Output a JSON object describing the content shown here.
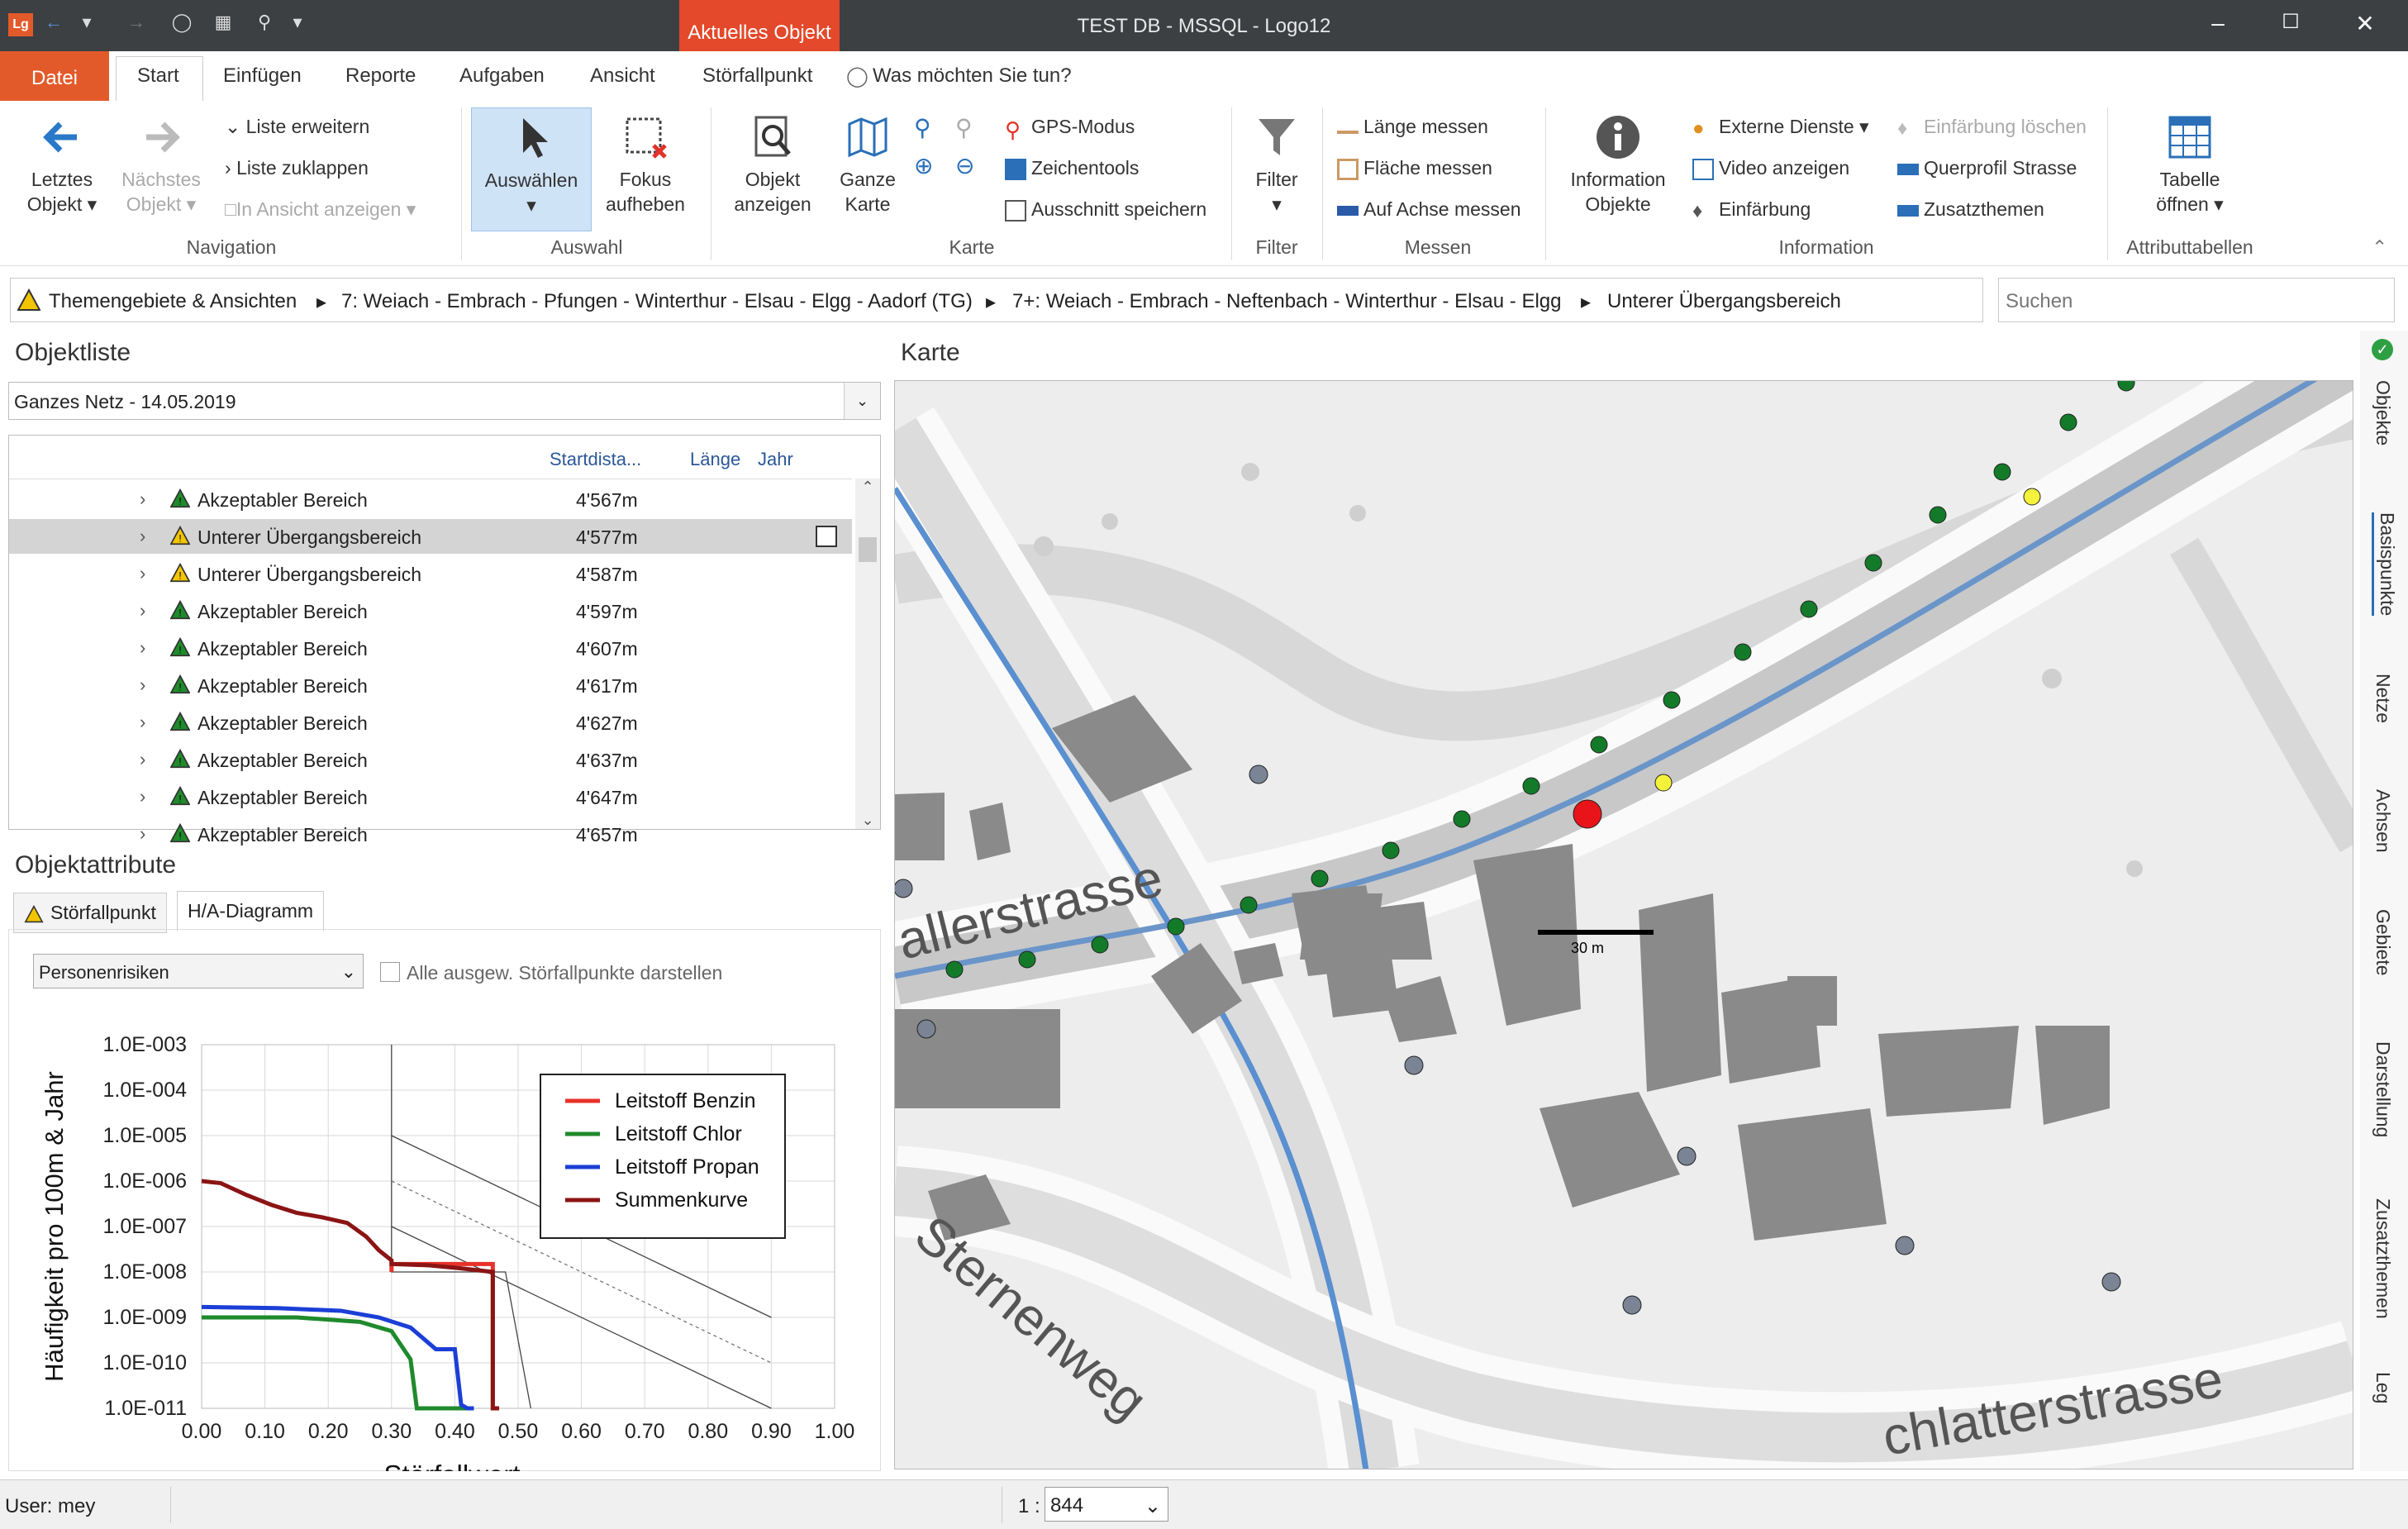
{
  "window": {
    "title": "TEST DB - MSSQL - Logo12",
    "context_tab": "Aktuelles Objekt",
    "app_icon": "Lg"
  },
  "ribbon_tabs": [
    "Datei",
    "Start",
    "Einfügen",
    "Reporte",
    "Aufgaben",
    "Ansicht",
    "Störfallpunkt"
  ],
  "tell_me": "Was möchten Sie tun?",
  "ribbon": {
    "navigation": {
      "label": "Navigation",
      "last_object": [
        "Letztes",
        "Objekt"
      ],
      "next_object": [
        "Nächstes",
        "Objekt"
      ],
      "expand_list": "Liste erweitern",
      "collapse_list": "Liste zuklappen",
      "show_in_view": "In Ansicht anzeigen"
    },
    "auswahl": {
      "label": "Auswahl",
      "select": "Auswählen",
      "focus": [
        "Fokus",
        "aufheben"
      ]
    },
    "karte": {
      "label": "Karte",
      "show_object": [
        "Objekt",
        "anzeigen"
      ],
      "whole_map": [
        "Ganze",
        "Karte"
      ],
      "gps": "GPS-Modus",
      "drawing_tools": "Zeichentools",
      "save_clip": "Ausschnitt speichern"
    },
    "filter": {
      "label": "Filter",
      "button": "Filter"
    },
    "messen": {
      "label": "Messen",
      "length": "Länge messen",
      "area": "Fläche messen",
      "axis": "Auf Achse messen"
    },
    "information": {
      "label": "Information",
      "info_objects": [
        "Information",
        "Objekte"
      ],
      "external": "Externe Dienste",
      "video": "Video anzeigen",
      "coloring": "Einfärbung",
      "clear_coloring": "Einfärbung löschen",
      "profile": "Querprofil Strasse",
      "extra_themes": "Zusatzthemen"
    },
    "attributtabellen": {
      "label": "Attributtabellen",
      "open_table": [
        "Tabelle",
        "öffnen"
      ]
    }
  },
  "breadcrumb": [
    "Themengebiete & Ansichten",
    "7: Weiach - Embrach - Pfungen - Winterthur - Elsau - Elgg - Aadorf (TG)",
    "7+: Weiach - Embrach - Neftenbach - Winterthur - Elsau - Elgg",
    "Unterer Übergangsbereich"
  ],
  "search_placeholder": "Suchen",
  "objektliste": {
    "title": "Objektliste",
    "network": "Ganzes Netz - 14.05.2019",
    "columns": [
      "Startdista...",
      "Länge",
      "Jahr"
    ],
    "rows": [
      {
        "name": "Akzeptabler Bereich",
        "dist": "4'567m",
        "kind": "green"
      },
      {
        "name": "Unterer Übergangsbereich",
        "dist": "4'577m",
        "kind": "yellow",
        "selected": true
      },
      {
        "name": "Unterer Übergangsbereich",
        "dist": "4'587m",
        "kind": "yellow"
      },
      {
        "name": "Akzeptabler Bereich",
        "dist": "4'597m",
        "kind": "green"
      },
      {
        "name": "Akzeptabler Bereich",
        "dist": "4'607m",
        "kind": "green"
      },
      {
        "name": "Akzeptabler Bereich",
        "dist": "4'617m",
        "kind": "green"
      },
      {
        "name": "Akzeptabler Bereich",
        "dist": "4'627m",
        "kind": "green"
      },
      {
        "name": "Akzeptabler Bereich",
        "dist": "4'637m",
        "kind": "green"
      },
      {
        "name": "Akzeptabler Bereich",
        "dist": "4'647m",
        "kind": "green"
      },
      {
        "name": "Akzeptabler Bereich",
        "dist": "4'657m",
        "kind": "green"
      }
    ]
  },
  "attribute": {
    "title": "Objektattribute",
    "tabs": [
      "Störfallpunkt",
      "H/A-Diagramm"
    ],
    "risk_select": "Personenrisiken",
    "show_all": "Alle ausgew. Störfallpunkte darstellen"
  },
  "chart_data": {
    "type": "line",
    "xlabel": "Störfallwert",
    "ylabel": "Häufigkeit pro 100m & Jahr",
    "xlim": [
      0,
      1
    ],
    "x_ticks": [
      "0.00",
      "0.10",
      "0.20",
      "0.30",
      "0.40",
      "0.50",
      "0.60",
      "0.70",
      "0.80",
      "0.90",
      "1.00"
    ],
    "y_ticks": [
      "1.0E-003",
      "1.0E-004",
      "1.0E-005",
      "1.0E-006",
      "1.0E-007",
      "1.0E-008",
      "1.0E-009",
      "1.0E-010",
      "1.0E-011"
    ],
    "y_scale": "log",
    "ylim": [
      1e-11,
      0.001
    ],
    "legend_position": "top-right",
    "series": [
      {
        "name": "Leitstoff Benzin",
        "color": "#e8312a",
        "x": [
          0.3,
          0.3,
          0.46,
          0.46,
          0.47
        ],
        "y": [
          1e-08,
          1.5e-08,
          1.5e-08,
          1e-11,
          1e-11
        ]
      },
      {
        "name": "Leitstoff Chlor",
        "color": "#1f8a2c",
        "x": [
          0.0,
          0.15,
          0.25,
          0.3,
          0.33,
          0.34,
          0.4,
          0.43
        ],
        "y": [
          1e-09,
          1e-09,
          8e-10,
          5e-10,
          1.2e-10,
          1e-11,
          1e-11,
          1e-11
        ]
      },
      {
        "name": "Leitstoff Propan",
        "color": "#1b3fd6",
        "x": [
          0.0,
          0.12,
          0.22,
          0.28,
          0.33,
          0.37,
          0.4,
          0.41,
          0.42,
          0.43
        ],
        "y": [
          1.7e-09,
          1.6e-09,
          1.4e-09,
          1e-09,
          6e-10,
          2e-10,
          2e-10,
          1.2e-11,
          1e-11,
          1e-11
        ]
      },
      {
        "name": "Summenkurve",
        "color": "#8b1414",
        "x": [
          0.0,
          0.03,
          0.07,
          0.11,
          0.15,
          0.19,
          0.23,
          0.26,
          0.28,
          0.3,
          0.3,
          0.36,
          0.41,
          0.46,
          0.46,
          0.47
        ],
        "y": [
          1e-06,
          9e-07,
          5e-07,
          3e-07,
          2e-07,
          1.6e-07,
          1.2e-07,
          6e-08,
          3e-08,
          1.8e-08,
          1.5e-08,
          1.4e-08,
          1.2e-08,
          1e-08,
          1e-11,
          1e-11
        ]
      }
    ]
  },
  "map": {
    "title": "Karte",
    "labels": [
      "allerstrasse",
      "Sternenweg",
      "chlatterstrasse"
    ],
    "scale_label": "30 m"
  },
  "side_panel": [
    "Objekte",
    "Basispunkte",
    "Netze",
    "Achsen",
    "Gebiete",
    "Darstellung",
    "Zusatzthemen",
    "Leg"
  ],
  "status": {
    "user": "User: mey",
    "scale_prefix": "1 :",
    "scale": "844"
  }
}
